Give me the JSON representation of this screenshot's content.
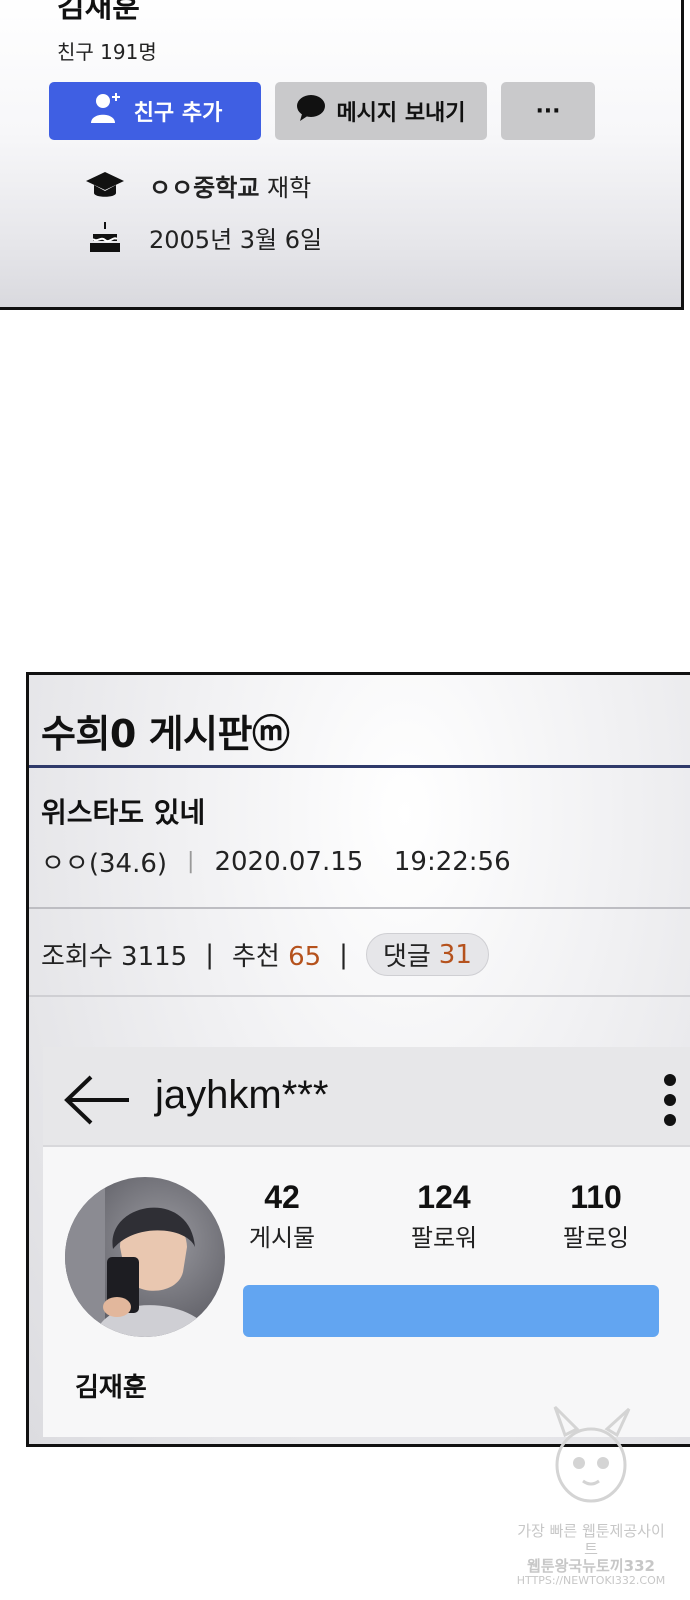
{
  "profile": {
    "name": "김재훈",
    "friends": "친구 191명",
    "add_friend_label": "친구 추가",
    "message_label": "메시지 보내기",
    "more_label": "···",
    "school_name": "ㅇㅇ중학교",
    "school_status": "재학",
    "birthday": "2005년 3월 6일",
    "icons": [
      "add-friend-icon",
      "chat-bubble-icon",
      "graduation-cap-icon",
      "cake-icon"
    ],
    "colors": {
      "add_button": "#3f5fe3",
      "secondary_button": "#c9c9cb"
    }
  },
  "board": {
    "title": "수희0 게시판ⓜ",
    "post_title": "위스타도 있네",
    "author": "ㅇㅇ(34.6)",
    "date": "2020.07.15",
    "time": "19:22:56",
    "views_label": "조회수 3115",
    "recommend_label": "추천",
    "recommend_count": "65",
    "comment_label": "댓글",
    "comment_count": "31",
    "separator": "|",
    "colors": {
      "accent_rule": "#2f3a6a",
      "count": "#b5521d"
    }
  },
  "instagram": {
    "username": "jayhkm***",
    "posts_count": "42",
    "posts_label": "게시물",
    "followers_count": "124",
    "followers_label": "팔로워",
    "following_count": "110",
    "following_label": "팔로잉",
    "display_name": "김재훈",
    "icons": [
      "back-arrow-icon",
      "kebab-menu-icon"
    ],
    "colors": {
      "follow_bar": "#62a5f1"
    }
  },
  "watermark": {
    "line1": "가장 빠른 웹툰제공사이트",
    "line2": "웹툰왕국뉴토끼332",
    "url": "HTTPS://NEWTOKI332.COM"
  }
}
